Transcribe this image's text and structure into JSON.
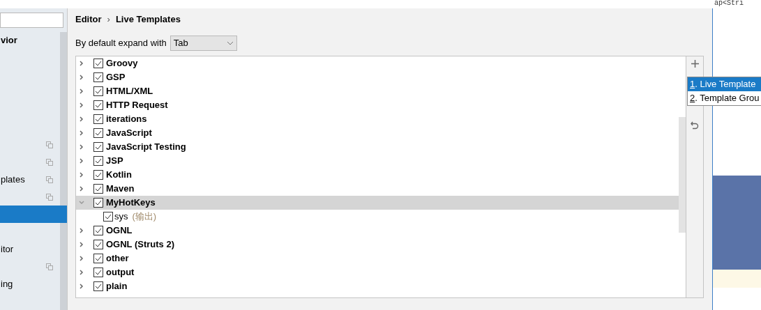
{
  "editor_snippet": "ap<Stri",
  "sidebar": {
    "items": [
      {
        "label": "vior",
        "bold": true,
        "copy": false,
        "selected": false
      },
      {
        "copy": false,
        "selected": false
      },
      {
        "copy": false,
        "selected": false
      },
      {
        "copy": false,
        "selected": false
      },
      {
        "copy": false,
        "selected": false
      },
      {
        "copy": false,
        "selected": false
      },
      {
        "copy": true,
        "selected": false
      },
      {
        "copy": true,
        "selected": false
      },
      {
        "label": "plates",
        "copy": true,
        "selected": false
      },
      {
        "copy": true,
        "selected": false
      },
      {
        "copy": false,
        "selected": true
      },
      {
        "copy": false,
        "selected": false
      },
      {
        "label": "itor",
        "copy": false,
        "selected": false
      },
      {
        "copy": true,
        "selected": false
      },
      {
        "label": "ing",
        "copy": false,
        "selected": false
      }
    ]
  },
  "breadcrumb": [
    "Editor",
    "›",
    "Live Templates"
  ],
  "expand_with": {
    "label": "By default expand with",
    "value": "Tab"
  },
  "templates": [
    {
      "label": "Groovy",
      "checked": true,
      "expanded": false,
      "selected": false
    },
    {
      "label": "GSP",
      "checked": true,
      "expanded": false,
      "selected": false
    },
    {
      "label": "HTML/XML",
      "checked": true,
      "expanded": false,
      "selected": false
    },
    {
      "label": "HTTP Request",
      "checked": true,
      "expanded": false,
      "selected": false
    },
    {
      "label": "iterations",
      "checked": true,
      "expanded": false,
      "selected": false
    },
    {
      "label": "JavaScript",
      "checked": true,
      "expanded": false,
      "selected": false
    },
    {
      "label": "JavaScript Testing",
      "checked": true,
      "expanded": false,
      "selected": false
    },
    {
      "label": "JSP",
      "checked": true,
      "expanded": false,
      "selected": false
    },
    {
      "label": "Kotlin",
      "checked": true,
      "expanded": false,
      "selected": false
    },
    {
      "label": "Maven",
      "checked": true,
      "expanded": false,
      "selected": false
    },
    {
      "label": "MyHotKeys",
      "checked": true,
      "expanded": true,
      "selected": true,
      "children": [
        {
          "label": "sys",
          "description": "(输出)",
          "checked": true
        }
      ]
    },
    {
      "label": "OGNL",
      "checked": true,
      "expanded": false,
      "selected": false
    },
    {
      "label": "OGNL (Struts 2)",
      "checked": true,
      "expanded": false,
      "selected": false
    },
    {
      "label": "other",
      "checked": true,
      "expanded": false,
      "selected": false
    },
    {
      "label": "output",
      "checked": true,
      "expanded": false,
      "selected": false
    },
    {
      "label": "plain",
      "checked": true,
      "expanded": false,
      "selected": false
    }
  ],
  "add_menu": [
    {
      "mnemonic": "1",
      "label": ". Live Template",
      "selected": true
    },
    {
      "mnemonic": "2",
      "label": ". Template Grou",
      "selected": false
    }
  ]
}
